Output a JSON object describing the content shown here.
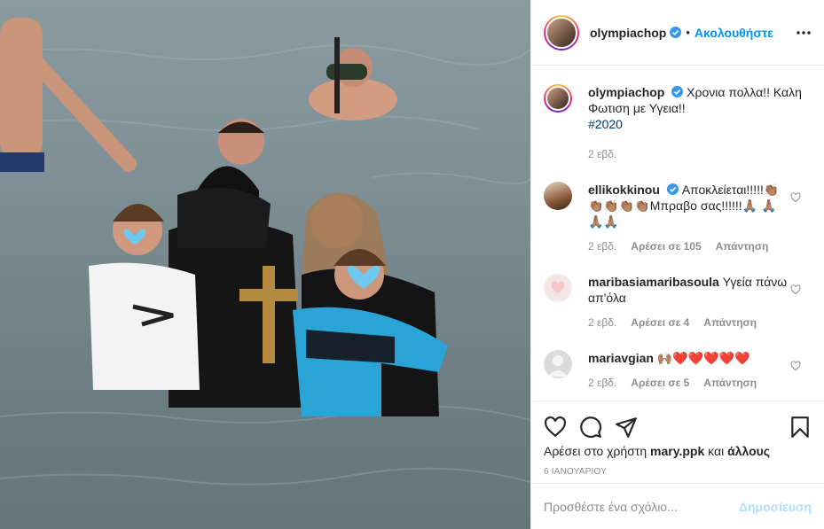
{
  "post": {
    "author": "olympiachop",
    "follow_label": "Ακολουθήστε",
    "separator": "•",
    "caption": {
      "user": "olympiachop",
      "text": "Χρονια πολλα!! Καλη Φωτιση με Υγεια!!",
      "hashtag": "#2020",
      "time": "2 εβδ."
    },
    "comments": [
      {
        "user": "ellikokkinou",
        "verified": true,
        "text": "Αποκλείεται!!!!!👏🏽 👏🏽👏🏽👏🏽👏🏽Μπραβο σας!!!!!!🙏🏽 🙏🏽🙏🏽🙏🏽",
        "time": "2 εβδ.",
        "likes": "Αρέσει σε 105",
        "reply": "Απάντηση"
      },
      {
        "user": "maribasiamaribasoula",
        "verified": false,
        "text": "Υγεία πάνω απ'όλα",
        "time": "2 εβδ.",
        "likes": "Αρέσει σε 4",
        "reply": "Απάντηση"
      },
      {
        "user": "mariavgian",
        "verified": false,
        "text": "🙌🏽❤️❤️❤️❤️❤️",
        "time": "2 εβδ.",
        "likes": "Αρέσει σε 5",
        "reply": "Απάντηση"
      }
    ],
    "liked_by_prefix": "Αρέσει στο χρήστη",
    "liked_by_user": "mary.ppk",
    "liked_by_and": "και",
    "liked_by_others": "άλλους",
    "date": "6 ΙΑΝΟΥΑΡΙΟΥ",
    "add_comment_placeholder": "Προσθέστε ένα σχόλιο...",
    "post_label": "Δημοσίευση"
  },
  "icons": {
    "verified": "verified-badge-icon",
    "more": "more-options-icon",
    "like": "heart-icon",
    "comment": "comment-bubble-icon",
    "share": "paper-plane-icon",
    "save": "bookmark-icon",
    "comment_like": "small-heart-icon"
  },
  "colors": {
    "accent": "#0095f6",
    "post_disabled": "#b2dffc",
    "muted": "#8e8e8e",
    "hashtag": "#00376b"
  }
}
